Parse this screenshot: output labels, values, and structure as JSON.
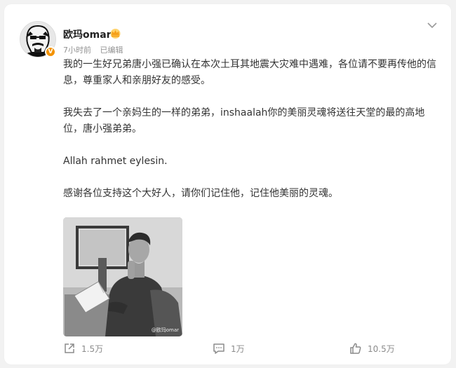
{
  "post": {
    "author": "欧玛omar",
    "time": "7小时前",
    "edited": "已编辑",
    "verify_badge_icon": "v-badge-icon",
    "member_icon": "crown-icon",
    "paragraphs": [
      "我的一生好兄弟唐小强已确认在本次土耳其地震大灾难中遇难，各位请不要再传他的信息，尊重家人和亲朋好友的感受。",
      "我失去了一个亲妈生的一样的弟弟，inshaalah你的美丽灵魂将送往天堂的最的高地位，唐小强弟弟。",
      "Allah rahmet eylesin.",
      "感谢各位支持这个大好人，请你们记住他，记住他美丽的灵魂。"
    ],
    "image_alt_icon": "photo-of-man-reading",
    "watermark": "@欧玛omar"
  },
  "actions": {
    "share_count": "1.5万",
    "comment_count": "1万",
    "like_count": "10.5万"
  },
  "colors": {
    "accent_orange": "#f39200",
    "meta_gray": "#939393",
    "text": "#333333"
  }
}
